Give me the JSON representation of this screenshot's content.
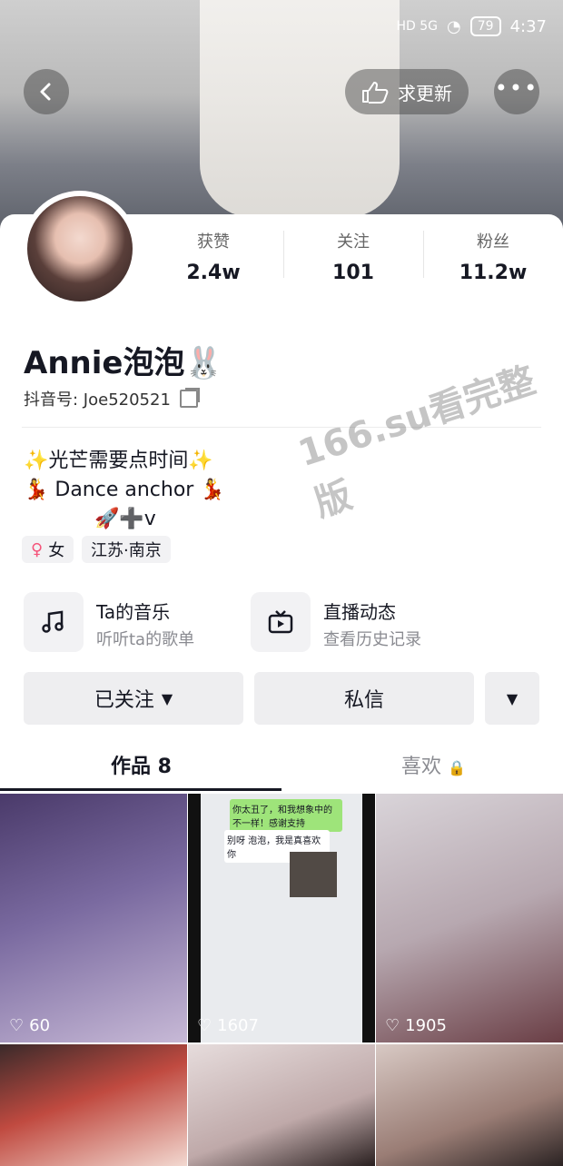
{
  "status": {
    "signal_text": "HD 5G",
    "battery": "79",
    "time": "4:37"
  },
  "topbar": {
    "update_label": "求更新"
  },
  "stats": [
    {
      "label": "获赞",
      "value": "2.4w"
    },
    {
      "label": "关注",
      "value": "101"
    },
    {
      "label": "粉丝",
      "value": "11.2w"
    }
  ],
  "profile": {
    "name": "Annie泡泡🐰",
    "id_prefix": "抖音号: ",
    "id_value": "Joe520521",
    "bio_lines": [
      "✨光芒需要点时间✨",
      "💃  Dance anchor  💃",
      "🚀➕v"
    ],
    "tags": [
      {
        "icon": "♀",
        "label": "女"
      },
      {
        "label": "江苏·南京"
      }
    ]
  },
  "features": [
    {
      "title": "Ta的音乐",
      "subtitle": "听听ta的歌单"
    },
    {
      "title": "直播动态",
      "subtitle": "查看历史记录"
    }
  ],
  "actions": {
    "follow_label": "已关注",
    "message_label": "私信"
  },
  "tabs": {
    "works_label": "作品 8",
    "likes_label": "喜欢"
  },
  "videos": [
    {
      "likes": "60"
    },
    {
      "likes": "1607"
    },
    {
      "likes": "1905"
    }
  ],
  "chat_snippet": {
    "msg1": "你太丑了，和我想象中的不一样！感谢支持",
    "msg2": "别呀 泡泡，我是真喜欢你"
  },
  "watermark": "166.su看完整版"
}
